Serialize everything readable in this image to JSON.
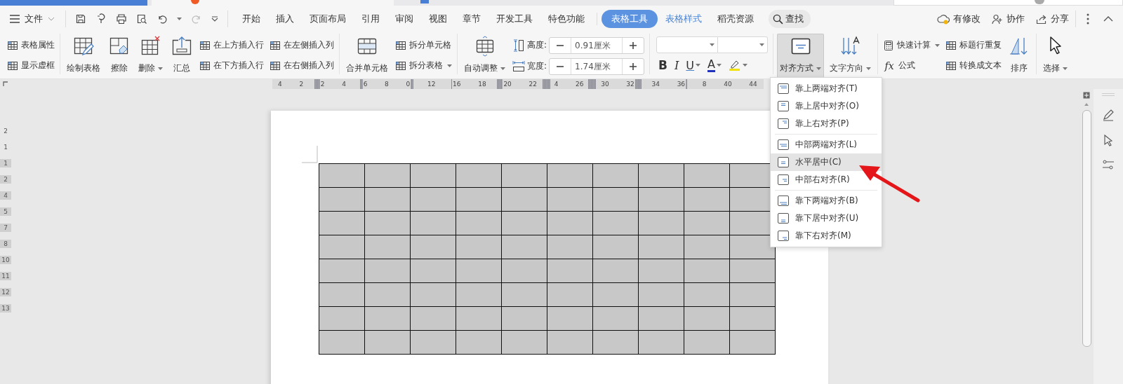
{
  "menu_bar": {
    "file_label": "文件",
    "tabs": [
      {
        "label": "开始",
        "kind": "normal",
        "selected": false
      },
      {
        "label": "插入",
        "kind": "normal",
        "selected": false
      },
      {
        "label": "页面布局",
        "kind": "normal",
        "selected": false
      },
      {
        "label": "引用",
        "kind": "normal",
        "selected": false
      },
      {
        "label": "审阅",
        "kind": "normal",
        "selected": false
      },
      {
        "label": "视图",
        "kind": "normal",
        "selected": false
      },
      {
        "label": "章节",
        "kind": "normal",
        "selected": false
      },
      {
        "label": "开发工具",
        "kind": "normal",
        "selected": false
      },
      {
        "label": "特色功能",
        "kind": "normal",
        "selected": false
      },
      {
        "label": "表格工具",
        "kind": "contextual",
        "selected": true
      },
      {
        "label": "表格样式",
        "kind": "contextual",
        "selected": false
      },
      {
        "label": "稻壳资源",
        "kind": "normal",
        "selected": false
      }
    ],
    "search_label": "查找",
    "actions": [
      "有修改",
      "协作",
      "分享"
    ]
  },
  "ribbon": [
    {
      "columns": [
        {
          "kind": "stack",
          "buttons": [
            {
              "label": "表格属性",
              "dropdown": false
            },
            {
              "label": "显示虚框",
              "dropdown": false
            }
          ]
        }
      ]
    },
    {
      "columns": [
        {
          "kind": "large",
          "label": "绘制表格",
          "dropdown": false,
          "pressed": false
        },
        {
          "kind": "large",
          "label": "擦除",
          "dropdown": false,
          "pressed": false
        },
        {
          "kind": "large",
          "label": "删除",
          "dropdown": true,
          "pressed": false
        },
        {
          "kind": "large",
          "label": "汇总",
          "dropdown": false,
          "pressed": false
        },
        {
          "kind": "stack",
          "buttons": [
            {
              "label": "在上方插入行",
              "dropdown": false
            },
            {
              "label": "在下方插入行",
              "dropdown": false
            }
          ]
        },
        {
          "kind": "stack",
          "buttons": [
            {
              "label": "在左侧插入列",
              "dropdown": false
            },
            {
              "label": "在右侧插入列",
              "dropdown": false
            }
          ]
        }
      ]
    },
    {
      "columns": [
        {
          "kind": "large",
          "label": "合并单元格",
          "dropdown": false,
          "pressed": false
        },
        {
          "kind": "stack",
          "buttons": [
            {
              "label": "拆分单元格",
              "dropdown": false
            },
            {
              "label": "拆分表格",
              "dropdown": true
            }
          ]
        }
      ]
    },
    {
      "columns": [
        {
          "kind": "large",
          "label": "自动调整",
          "dropdown": true,
          "pressed": false
        },
        {
          "kind": "size",
          "fields": [
            {
              "label": "高度:",
              "value": "0.91厘米"
            },
            {
              "label": "宽度:",
              "value": "1.74厘米"
            }
          ]
        }
      ]
    },
    {
      "columns": [
        {
          "kind": "font",
          "formats": [
            {
              "kind": "bold",
              "label": "B",
              "dropdown": false
            },
            {
              "kind": "italic",
              "label": "I",
              "dropdown": false
            },
            {
              "kind": "underline",
              "label": "U",
              "dropdown": true
            },
            {
              "kind": "font_color",
              "label": "A",
              "dropdown": true
            },
            {
              "kind": "highlight",
              "dropdown": true
            }
          ]
        }
      ]
    },
    {
      "columns": [
        {
          "kind": "large",
          "label": "对齐方式",
          "dropdown": true,
          "pressed": true
        },
        {
          "kind": "large",
          "label": "文字方向",
          "dropdown": true,
          "pressed": false
        }
      ]
    },
    {
      "columns": [
        {
          "kind": "stack",
          "buttons": [
            {
              "label": "快速计算",
              "dropdown": true
            },
            {
              "label": "公式",
              "icon_text": "fx",
              "dropdown": false
            }
          ]
        },
        {
          "kind": "stack",
          "buttons": [
            {
              "label": "标题行重复",
              "dropdown": false
            },
            {
              "label": "转换成文本",
              "dropdown": false
            }
          ]
        },
        {
          "kind": "large",
          "label": "排序",
          "dropdown": false,
          "pressed": false
        }
      ]
    },
    {
      "columns": [
        {
          "kind": "large",
          "label": "选择",
          "dropdown": true,
          "pressed": false
        }
      ]
    }
  ],
  "ruler": {
    "labels": [
      "4",
      "2",
      "2",
      "4",
      "6",
      "8",
      "0",
      "12",
      "16",
      "18",
      "20",
      "22",
      "4",
      "26",
      "30",
      "32",
      "34",
      "36",
      "8",
      "40",
      "44"
    ],
    "vertical_labels": [
      "2",
      "1",
      "1",
      "2",
      "4",
      "5",
      "7",
      "8",
      "10",
      "11",
      "12",
      "13"
    ]
  },
  "table": {
    "rows": [
      {
        "cells": [
          {
            "selected": true
          },
          {
            "selected": true
          },
          {
            "selected": true
          },
          {
            "selected": true
          },
          {
            "selected": true
          },
          {
            "selected": true
          },
          {
            "selected": true
          },
          {
            "selected": true
          },
          {
            "selected": true
          },
          {
            "selected": true
          }
        ]
      },
      {
        "cells": [
          {
            "selected": true
          },
          {
            "selected": true
          },
          {
            "selected": true
          },
          {
            "selected": true
          },
          {
            "selected": true
          },
          {
            "selected": true
          },
          {
            "selected": true
          },
          {
            "selected": true
          },
          {
            "selected": true
          },
          {
            "selected": true
          }
        ]
      },
      {
        "cells": [
          {
            "selected": true
          },
          {
            "selected": true
          },
          {
            "selected": true
          },
          {
            "selected": true
          },
          {
            "selected": true
          },
          {
            "selected": true
          },
          {
            "selected": true
          },
          {
            "selected": true
          },
          {
            "selected": true
          },
          {
            "selected": true
          }
        ]
      },
      {
        "cells": [
          {
            "selected": true
          },
          {
            "selected": true
          },
          {
            "selected": true
          },
          {
            "selected": true
          },
          {
            "selected": true
          },
          {
            "selected": true
          },
          {
            "selected": true
          },
          {
            "selected": true
          },
          {
            "selected": true
          },
          {
            "selected": true
          }
        ]
      },
      {
        "cells": [
          {
            "selected": true
          },
          {
            "selected": true
          },
          {
            "selected": true
          },
          {
            "selected": true
          },
          {
            "selected": true
          },
          {
            "selected": true
          },
          {
            "selected": true
          },
          {
            "selected": true
          },
          {
            "selected": true
          },
          {
            "selected": true
          }
        ]
      },
      {
        "cells": [
          {
            "selected": true
          },
          {
            "selected": true
          },
          {
            "selected": true
          },
          {
            "selected": true
          },
          {
            "selected": true
          },
          {
            "selected": true
          },
          {
            "selected": true
          },
          {
            "selected": true
          },
          {
            "selected": true
          },
          {
            "selected": true
          }
        ]
      },
      {
        "cells": [
          {
            "selected": true
          },
          {
            "selected": true
          },
          {
            "selected": true
          },
          {
            "selected": true
          },
          {
            "selected": true
          },
          {
            "selected": true
          },
          {
            "selected": true
          },
          {
            "selected": true
          },
          {
            "selected": true
          },
          {
            "selected": true
          }
        ]
      },
      {
        "cells": [
          {
            "selected": true
          },
          {
            "selected": true
          },
          {
            "selected": true
          },
          {
            "selected": true
          },
          {
            "selected": true
          },
          {
            "selected": true
          },
          {
            "selected": true
          },
          {
            "selected": true
          },
          {
            "selected": true
          },
          {
            "selected": true
          }
        ]
      }
    ]
  },
  "align_menu": {
    "groups": [
      {
        "items": [
          {
            "label": "靠上两端对齐(T)",
            "selected": false
          },
          {
            "label": "靠上居中对齐(O)",
            "selected": false
          },
          {
            "label": "靠上右对齐(P)",
            "selected": false
          }
        ]
      },
      {
        "items": [
          {
            "label": "中部两端对齐(L)",
            "selected": false
          },
          {
            "label": "水平居中(C)",
            "selected": true
          },
          {
            "label": "中部右对齐(R)",
            "selected": false
          }
        ]
      },
      {
        "items": [
          {
            "label": "靠下两端对齐(B)",
            "selected": false
          },
          {
            "label": "靠下居中对齐(U)",
            "selected": false
          },
          {
            "label": "靠下右对齐(M)",
            "selected": false
          }
        ]
      }
    ]
  }
}
